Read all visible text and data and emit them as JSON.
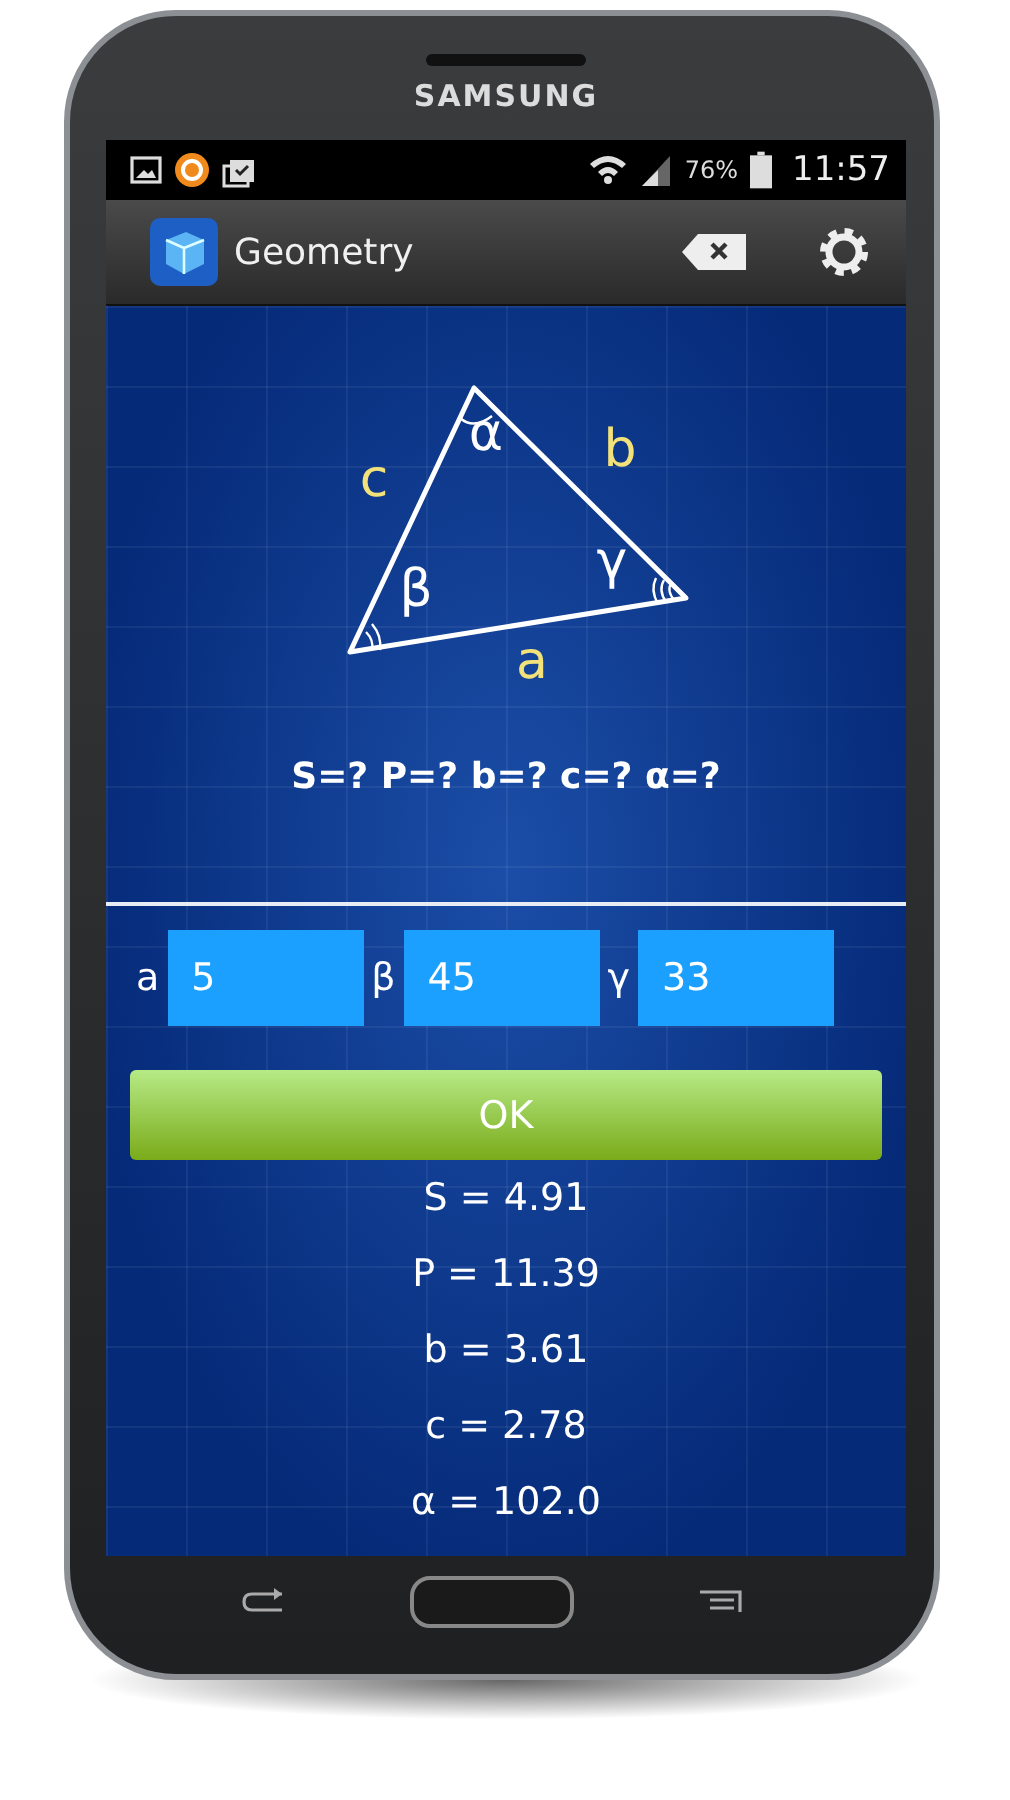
{
  "device": {
    "brand": "SAMSUNG"
  },
  "status_bar": {
    "battery": "76%",
    "time": "11:57"
  },
  "app_bar": {
    "title": "Geometry"
  },
  "diagram_labels": [
    {
      "text": "c",
      "kind": "side"
    },
    {
      "text": "α",
      "kind": "angle"
    },
    {
      "text": "b",
      "kind": "side"
    },
    {
      "text": "β",
      "kind": "angle"
    },
    {
      "text": "γ",
      "kind": "angle"
    },
    {
      "text": "a",
      "kind": "side"
    }
  ],
  "prompt": "S=? P=? b=? c=? α=?",
  "inputs": [
    {
      "label": "a",
      "value": "5"
    },
    {
      "label": "β",
      "value": "45"
    },
    {
      "label": "γ",
      "value": "33"
    }
  ],
  "ok_button": "OK",
  "results": [
    "S = 4.91",
    "P = 11.39",
    "b = 3.61",
    "c = 2.78",
    "α = 102.0"
  ]
}
